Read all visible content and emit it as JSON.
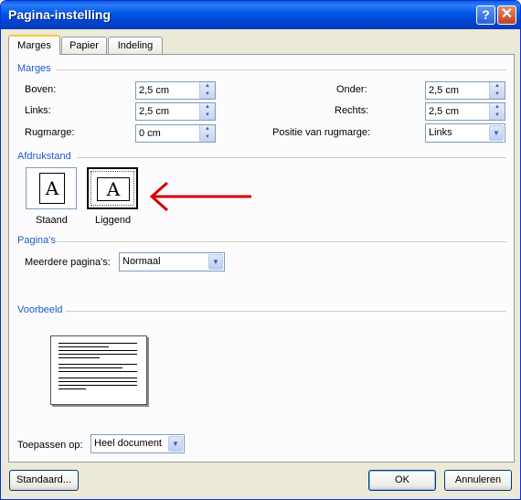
{
  "window": {
    "title": "Pagina-instelling",
    "help_glyph": "?",
    "close_glyph": "✕"
  },
  "tabs": [
    {
      "label": "Marges",
      "active": true
    },
    {
      "label": "Papier",
      "active": false
    },
    {
      "label": "Indeling",
      "active": false
    }
  ],
  "margins": {
    "section": "Marges",
    "top": {
      "label": "Boven:",
      "value": "2,5 cm"
    },
    "left": {
      "label": "Links:",
      "value": "2,5 cm"
    },
    "gutter": {
      "label": "Rugmarge:",
      "value": "0 cm"
    },
    "bottom": {
      "label": "Onder:",
      "value": "2,5 cm"
    },
    "right": {
      "label": "Rechts:",
      "value": "2,5 cm"
    },
    "gutter_position": {
      "label": "Positie van rugmarge:",
      "value": "Links"
    }
  },
  "orientation": {
    "section": "Afdrukstand",
    "portrait": {
      "label": "Staand",
      "glyph": "A"
    },
    "landscape": {
      "label": "Liggend",
      "glyph": "A",
      "selected": true
    }
  },
  "pages": {
    "section": "Pagina's",
    "multiple": {
      "label": "Meerdere pagina's:",
      "value": "Normaal"
    }
  },
  "preview": {
    "section": "Voorbeeld"
  },
  "apply": {
    "label": "Toepassen op:",
    "value": "Heel document"
  },
  "buttons": {
    "default": "Standaard...",
    "ok": "OK",
    "cancel": "Annuleren"
  },
  "colors": {
    "title_bar": "#0055e5",
    "section_label": "#1d5cc6",
    "annotation_arrow": "#d40000",
    "tab_highlight": "#ffc83c"
  }
}
